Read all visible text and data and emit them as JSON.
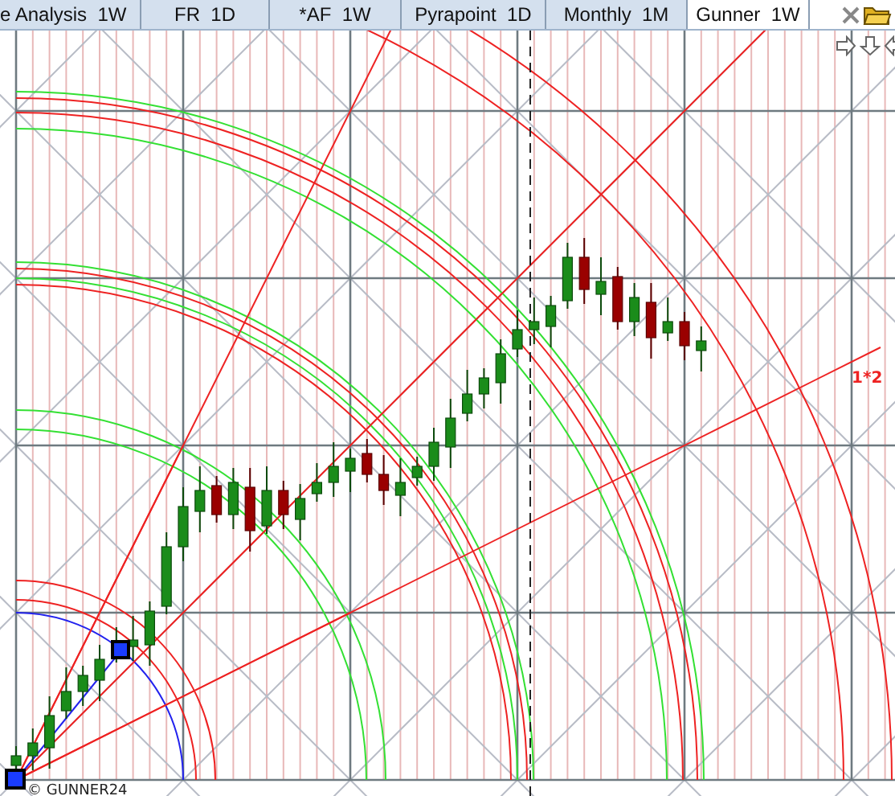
{
  "tabs": [
    {
      "label": "e Analysis  1W",
      "selected": false
    },
    {
      "label": "FR  1D",
      "selected": false
    },
    {
      "label": "*AF  1W",
      "selected": false
    },
    {
      "label": "Pyrapoint  1D",
      "selected": false
    },
    {
      "label": "Monthly  1M",
      "selected": false
    },
    {
      "label": "Gunner  1W",
      "selected": true
    }
  ],
  "chart": {
    "line_label": "1*2",
    "copyright": "© GUNNER24"
  }
}
